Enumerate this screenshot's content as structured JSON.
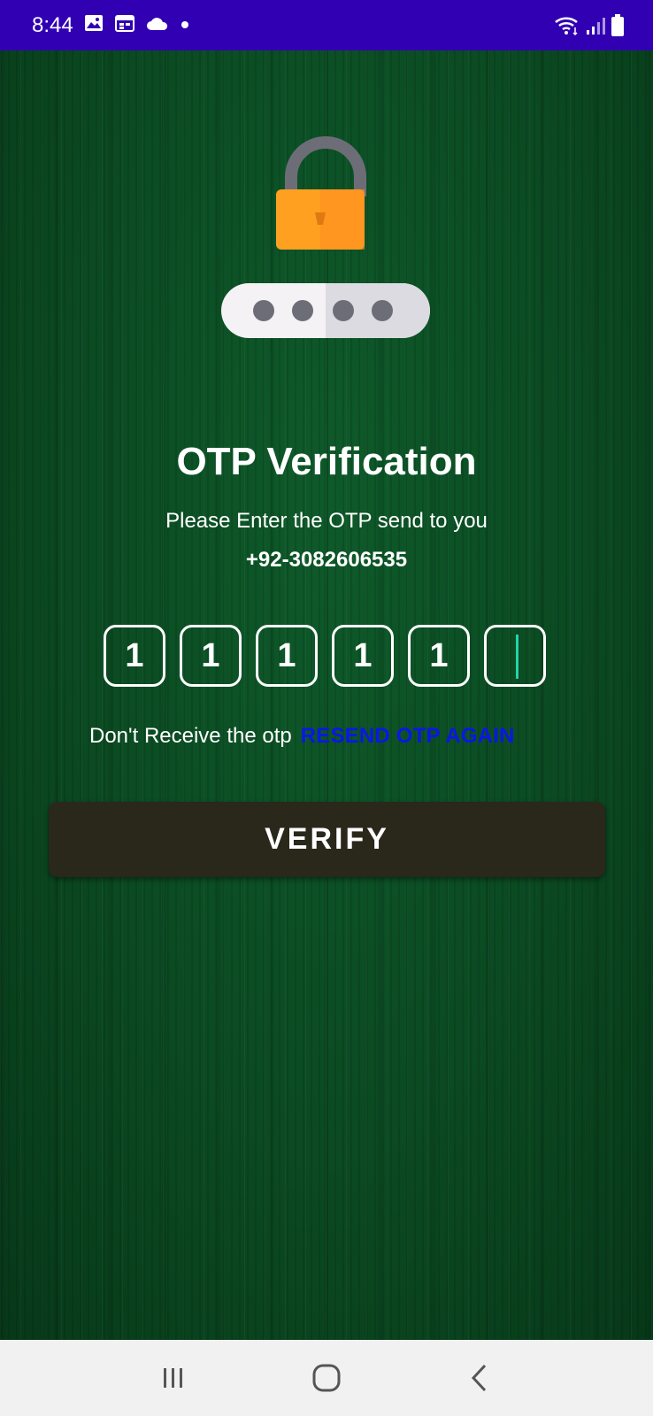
{
  "status_bar": {
    "time": "8:44",
    "left_icons": [
      "image-icon",
      "calendar-icon",
      "cloud-icon",
      "dot-icon"
    ],
    "right_icons": [
      "wifi-icon",
      "signal-icon",
      "battery-icon"
    ],
    "background": "#3100b3"
  },
  "otp": {
    "title": "OTP Verification",
    "subtitle": "Please Enter the OTP send to you",
    "phone": "+92-3082606535",
    "digits": [
      "1",
      "1",
      "1",
      "1",
      "1",
      ""
    ],
    "resend_prompt": "Don't Receive the otp",
    "resend_link": "RESEND OTP AGAIN",
    "verify_label": "VERIFY"
  },
  "colors": {
    "background": "#0b4a22",
    "lock_body": "#ffa020",
    "lock_shackle": "#6d6d78",
    "resend_link": "#0a17e6",
    "button": "#2a271b",
    "cursor": "#25d3a8"
  },
  "nav_bar": {
    "icons": [
      "recent-apps-icon",
      "home-icon",
      "back-icon"
    ]
  }
}
